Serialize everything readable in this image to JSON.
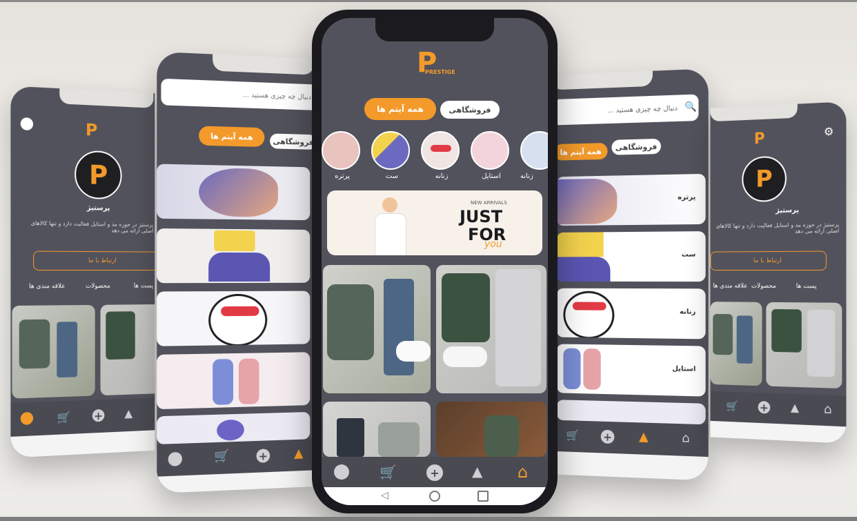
{
  "brand": {
    "logo_letter": "P",
    "logo_word": "PRESTIGE"
  },
  "search": {
    "placeholder": "دنبال چه چیزی هستید ..."
  },
  "tabs": {
    "all": "همه آیتم ها",
    "shop": "فروشگاهی"
  },
  "categories": [
    {
      "label": "پرتره",
      "color": "#e9c3be"
    },
    {
      "label": "ست",
      "color": "#d9d7ea"
    },
    {
      "label": "زنانه",
      "color": "#f1e5e3"
    },
    {
      "label": "استایل",
      "color": "#f3d4dd"
    },
    {
      "label": "زنانه",
      "color": "#d7e0ef"
    }
  ],
  "banner": {
    "kicker": "NEW ARRIVALS",
    "line1": "JUST",
    "line2": "FOR",
    "script": "you"
  },
  "profile": {
    "name": "پرستیژ",
    "bio": "پرستیژ در حوزه مد و استایل فعالیت دارد و تنها کالاهای اصلی ارائه می دهد",
    "contact": "ارتباط با ما",
    "tabs": [
      "پست ها",
      "محصولات",
      "علاقه مندی ها"
    ]
  },
  "category_list": [
    "پرتره",
    "ست",
    "زنانه",
    "استایل"
  ],
  "colors": {
    "accent": "#f39a2b",
    "surface": "#52525c",
    "nav": "#4a4a53"
  },
  "nav_icons": [
    "profile-icon",
    "cart-icon",
    "add-icon",
    "shapes-icon",
    "home-icon"
  ]
}
